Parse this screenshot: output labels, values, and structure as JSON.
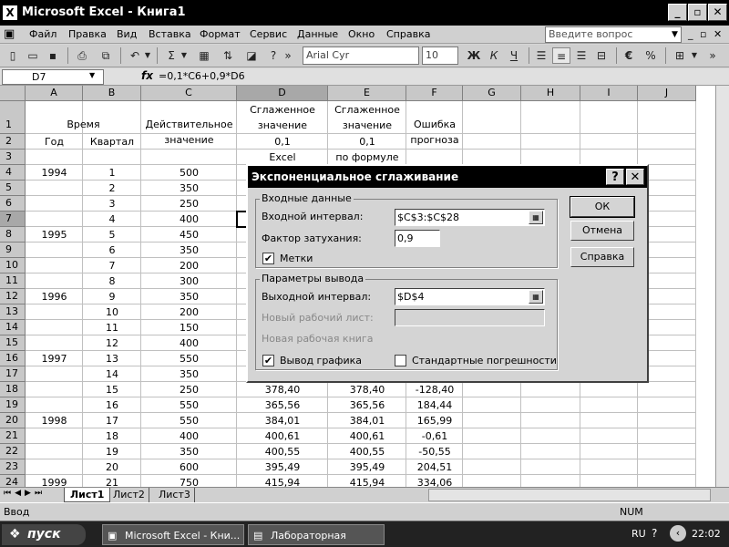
{
  "window": {
    "title": "Microsoft Excel - Книга1",
    "min": "_",
    "max": "▫",
    "close": "✕"
  },
  "menu": {
    "items": [
      "Файл",
      "Правка",
      "Вид",
      "Вставка",
      "Формат",
      "Сервис",
      "Данные",
      "Окно",
      "Справка"
    ],
    "ask_placeholder": "Введите вопрос"
  },
  "toolbar": {
    "font_name": "Arial Cyr",
    "font_size": "10",
    "bold": "Ж",
    "italic": "К",
    "underline": "Ч",
    "euro": "€"
  },
  "formula_bar": {
    "cell_ref": "D7",
    "fx": "fx",
    "formula": "=0,1*C6+0,9*D6"
  },
  "grid": {
    "columns": [
      "A",
      "B",
      "C",
      "D",
      "E",
      "F",
      "G",
      "H",
      "I",
      "J"
    ],
    "rows": [
      "1",
      "2",
      "3",
      "4",
      "5",
      "6",
      "7",
      "8",
      "9",
      "10",
      "11",
      "12",
      "13",
      "14",
      "15",
      "16",
      "17",
      "18",
      "19",
      "20",
      "21",
      "22",
      "23",
      "24"
    ],
    "headers": {
      "time": "Время",
      "year": "Год",
      "quarter": "Квартал",
      "actual_1": "Действительное",
      "actual_2": "значение",
      "smooth_d1": "Сглаженное",
      "smooth_d2": "значение",
      "alpha_d": "0,1",
      "excel": "Excel",
      "smooth_e1": "Сглаженное",
      "smooth_e2": "значение",
      "alpha_e": "0,1",
      "by_formula": "по формуле",
      "error_1": "Ошибка",
      "error_2": "прогноза"
    },
    "data": [
      {
        "row": 4,
        "A": "1994",
        "B": "1",
        "C": "500",
        "D": "",
        "E": "",
        "F": ""
      },
      {
        "row": 5,
        "A": "",
        "B": "2",
        "C": "350",
        "D": "",
        "E": "",
        "F": ""
      },
      {
        "row": 6,
        "A": "",
        "B": "3",
        "C": "250",
        "D": "",
        "E": "",
        "F": ""
      },
      {
        "row": 7,
        "A": "",
        "B": "4",
        "C": "400",
        "D": "",
        "E": "",
        "F": ""
      },
      {
        "row": 8,
        "A": "1995",
        "B": "5",
        "C": "450",
        "D": "",
        "E": "",
        "F": ""
      },
      {
        "row": 9,
        "A": "",
        "B": "6",
        "C": "350",
        "D": "",
        "E": "",
        "F": ""
      },
      {
        "row": 10,
        "A": "",
        "B": "7",
        "C": "200",
        "D": "",
        "E": "",
        "F": ""
      },
      {
        "row": 11,
        "A": "",
        "B": "8",
        "C": "300",
        "D": "",
        "E": "",
        "F": ""
      },
      {
        "row": 12,
        "A": "1996",
        "B": "9",
        "C": "350",
        "D": "",
        "E": "",
        "F": ""
      },
      {
        "row": 13,
        "A": "",
        "B": "10",
        "C": "200",
        "D": "",
        "E": "",
        "F": ""
      },
      {
        "row": 14,
        "A": "",
        "B": "11",
        "C": "150",
        "D": "",
        "E": "",
        "F": ""
      },
      {
        "row": 15,
        "A": "",
        "B": "12",
        "C": "400",
        "D": "",
        "E": "",
        "F": ""
      },
      {
        "row": 16,
        "A": "1997",
        "B": "13",
        "C": "550",
        "D": "",
        "E": "",
        "F": ""
      },
      {
        "row": 17,
        "A": "",
        "B": "14",
        "C": "350",
        "D": "",
        "E": "",
        "F": ""
      },
      {
        "row": 18,
        "A": "",
        "B": "15",
        "C": "250",
        "D": "378,40",
        "E": "378,40",
        "F": "-128,40"
      },
      {
        "row": 19,
        "A": "",
        "B": "16",
        "C": "550",
        "D": "365,56",
        "E": "365,56",
        "F": "184,44"
      },
      {
        "row": 20,
        "A": "1998",
        "B": "17",
        "C": "550",
        "D": "384,01",
        "E": "384,01",
        "F": "165,99"
      },
      {
        "row": 21,
        "A": "",
        "B": "18",
        "C": "400",
        "D": "400,61",
        "E": "400,61",
        "F": "-0,61"
      },
      {
        "row": 22,
        "A": "",
        "B": "19",
        "C": "350",
        "D": "400,55",
        "E": "400,55",
        "F": "-50,55"
      },
      {
        "row": 23,
        "A": "",
        "B": "20",
        "C": "600",
        "D": "395,49",
        "E": "395,49",
        "F": "204,51"
      },
      {
        "row": 24,
        "A": "1999",
        "B": "21",
        "C": "750",
        "D": "415,94",
        "E": "415,94",
        "F": "334,06"
      }
    ]
  },
  "sheets": {
    "tabs": [
      "Лист1",
      "Лист2",
      "Лист3"
    ],
    "active": "Лист1"
  },
  "status": {
    "left": "Ввод",
    "num": "NUM"
  },
  "taskbar": {
    "start": "пуск",
    "tasks": [
      "Microsoft Excel - Кни...",
      "Лабораторная рабо..."
    ],
    "lang": "RU",
    "clock": "22:02"
  },
  "dialog": {
    "title": "Экспоненциальное сглаживание",
    "help": "?",
    "close": "✕",
    "input_group": "Входные данные",
    "input_range_label": "Входной интервал:",
    "input_range_value": "$C$3:$C$28",
    "damping_label": "Фактор затухания:",
    "damping_value": "0,9",
    "labels_label": "Метки",
    "labels_checked": "✔",
    "output_group": "Параметры вывода",
    "output_range_label": "Выходной интервал:",
    "output_range_value": "$D$4",
    "new_sheet_label": "Новый рабочий лист:",
    "new_book_label": "Новая рабочая книга",
    "chart_output_label": "Вывод графика",
    "chart_output_checked": "✔",
    "std_errors_label": "Стандартные погрешности",
    "ok": "ОК",
    "cancel": "Отмена",
    "help_btn": "Справка"
  }
}
